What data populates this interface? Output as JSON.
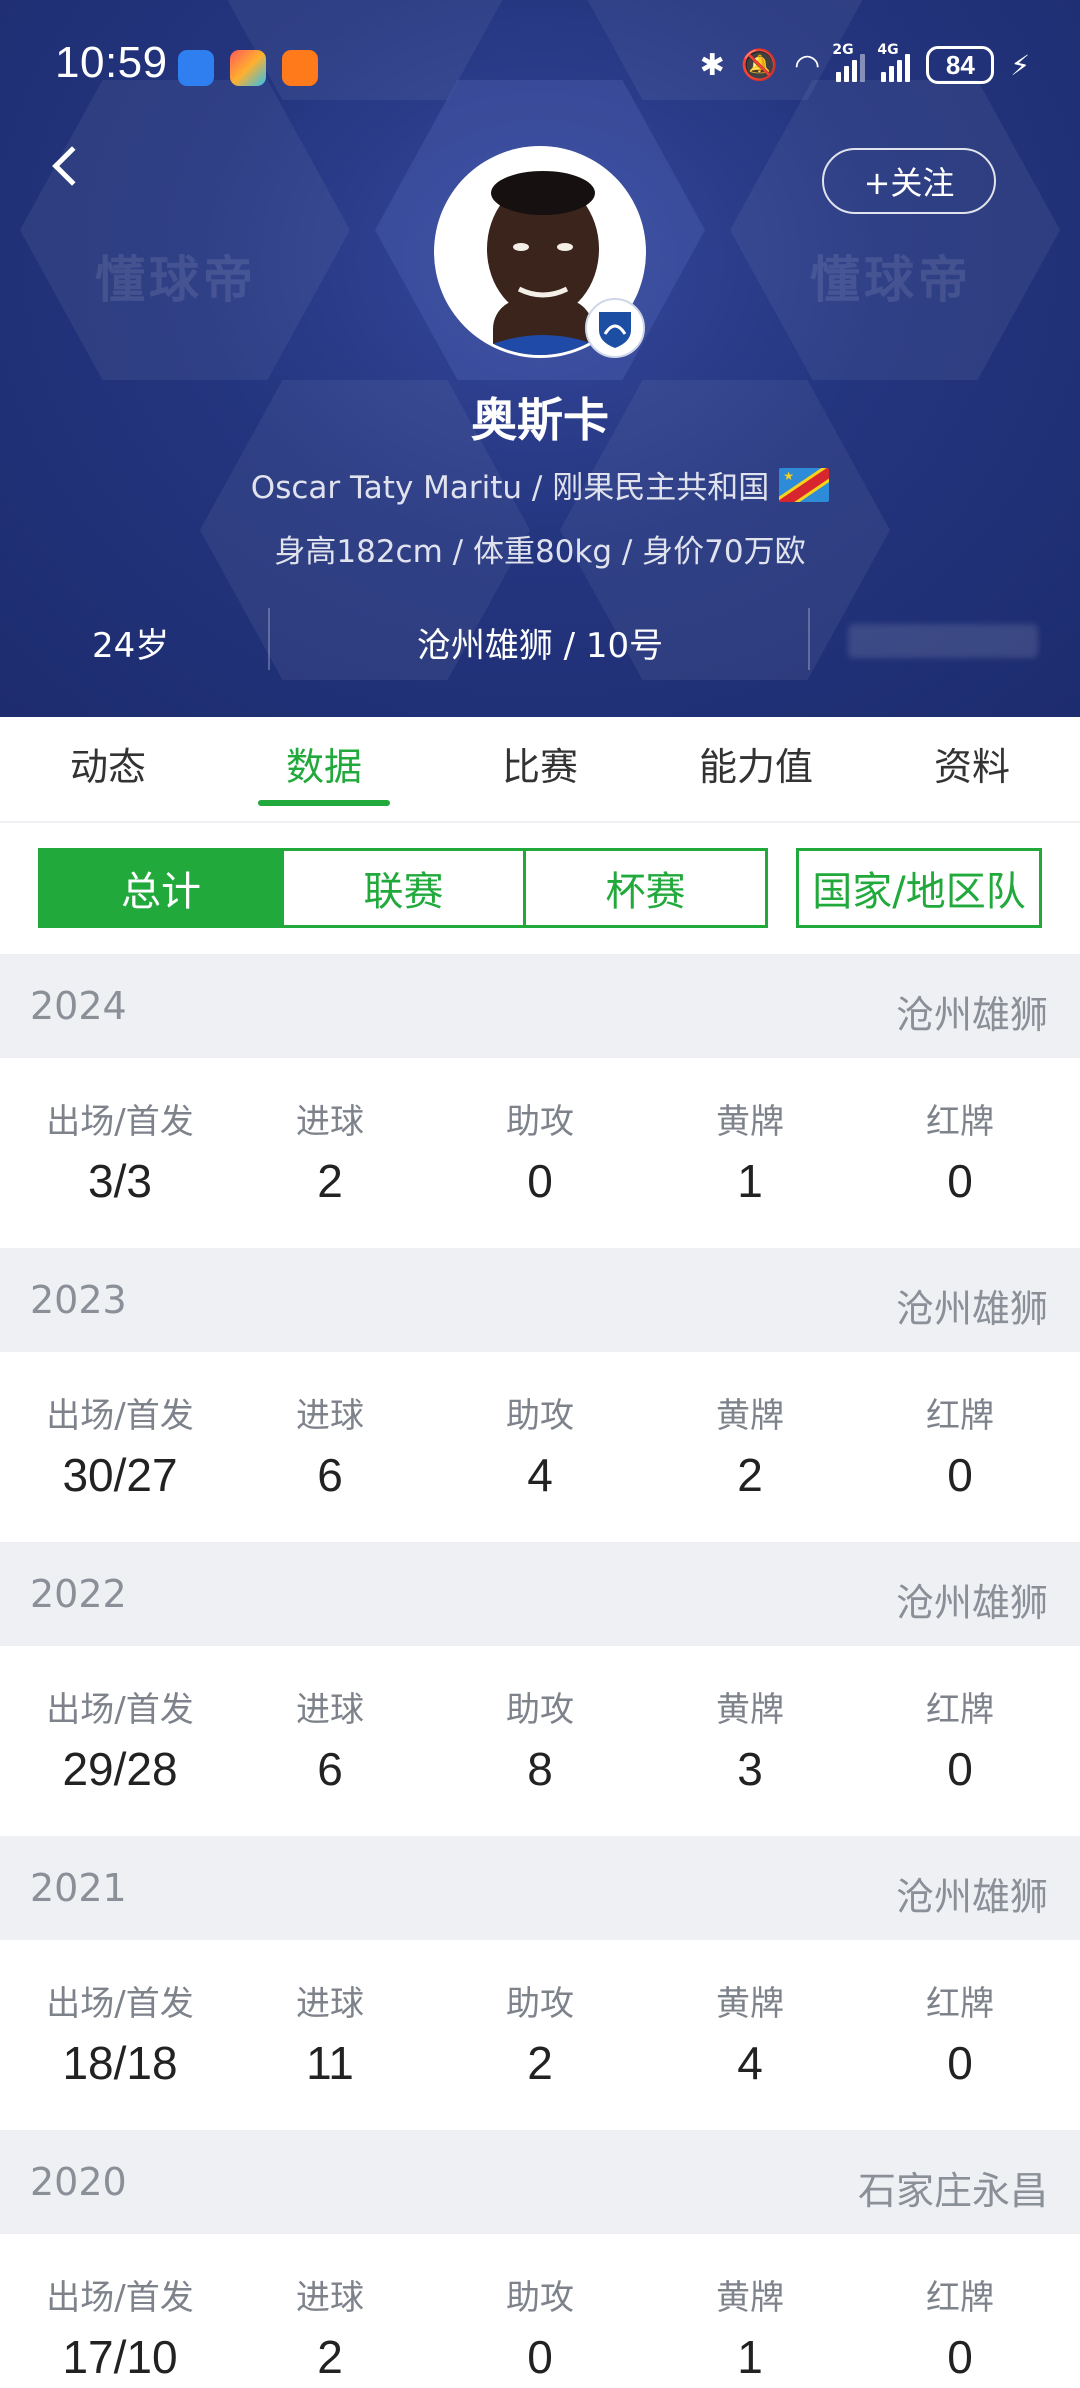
{
  "status_bar": {
    "time": "10:59",
    "battery": "84",
    "network_1": "2G",
    "network_2": "4G"
  },
  "header": {
    "watermark": "懂球帝",
    "follow_label": "+关注",
    "player_name": "奥斯卡",
    "full_name_country": "Oscar Taty Maritu / 刚果民主共和国",
    "body_info": "身高182cm / 体重80kg / 身价70万欧",
    "age": "24岁",
    "team_number": "沧州雄狮 / 10号"
  },
  "tabs": [
    {
      "label": "动态"
    },
    {
      "label": "数据"
    },
    {
      "label": "比赛"
    },
    {
      "label": "能力值"
    },
    {
      "label": "资料"
    }
  ],
  "active_tab": "数据",
  "filters": [
    {
      "label": "总计"
    },
    {
      "label": "联赛"
    },
    {
      "label": "杯赛"
    },
    {
      "label": "国家/地区队"
    }
  ],
  "stat_labels": {
    "apps": "出场/首发",
    "goals": "进球",
    "assists": "助攻",
    "yellow": "黄牌",
    "red": "红牌"
  },
  "seasons": [
    {
      "year": "2024",
      "club": "沧州雄狮",
      "apps": "3/3",
      "goals": "2",
      "assists": "0",
      "yellow": "1",
      "red": "0"
    },
    {
      "year": "2023",
      "club": "沧州雄狮",
      "apps": "30/27",
      "goals": "6",
      "assists": "4",
      "yellow": "2",
      "red": "0"
    },
    {
      "year": "2022",
      "club": "沧州雄狮",
      "apps": "29/28",
      "goals": "6",
      "assists": "8",
      "yellow": "3",
      "red": "0"
    },
    {
      "year": "2021",
      "club": "沧州雄狮",
      "apps": "18/18",
      "goals": "11",
      "assists": "2",
      "yellow": "4",
      "red": "0"
    },
    {
      "year": "2020",
      "club": "石家庄永昌",
      "apps": "17/10",
      "goals": "2",
      "assists": "0",
      "yellow": "1",
      "red": "0"
    }
  ],
  "colors": {
    "header_bg": "#24357f",
    "accent_green": "#22a93c",
    "season_bar": "#eef0f3"
  }
}
